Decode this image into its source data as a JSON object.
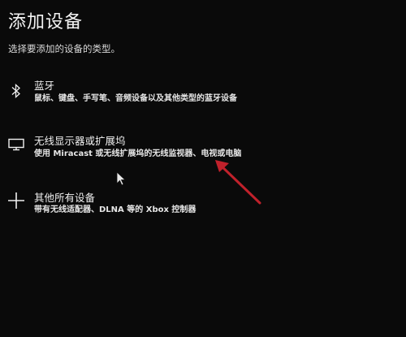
{
  "page": {
    "title": "添加设备",
    "subtitle": "选择要添加的设备的类型。"
  },
  "options": [
    {
      "title": "蓝牙",
      "description": "鼠标、键盘、手写笔、音频设备以及其他类型的蓝牙设备",
      "icon": "bluetooth-icon"
    },
    {
      "title": "无线显示器或扩展坞",
      "description": "使用 Miracast 或无线扩展坞的无线监视器、电视或电脑",
      "icon": "monitor-icon"
    },
    {
      "title": "其他所有设备",
      "description": "带有无线适配器、DLNA 等的 Xbox 控制器",
      "icon": "plus-icon"
    }
  ],
  "colors": {
    "background": "#0a0a0a",
    "text": "#ffffff",
    "annotation_arrow": "#c0212b"
  }
}
